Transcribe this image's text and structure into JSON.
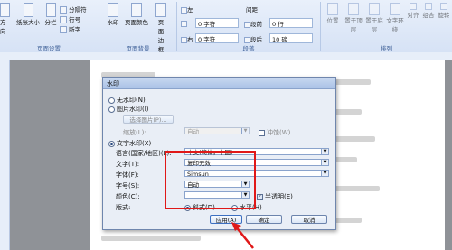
{
  "ribbon": {
    "row1": {
      "text_direction": "方向",
      "margins": "纸张大小",
      "columns": "分栏",
      "breaks": "分隔符",
      "line_numbers": "行号",
      "hyphenation": "断字",
      "watermark": "水印",
      "page_color": "页面颜色",
      "page_border": "页面边框"
    },
    "indent": {
      "left_label": "左",
      "left_value": "0 字符",
      "right_label": "右",
      "right_value": "0 字符"
    },
    "spacing": {
      "title": "间距",
      "before_label": "段前",
      "before_value": "0 行",
      "after_label": "段后",
      "after_value": "10 磅"
    },
    "groups": {
      "page_setup": "页面设置",
      "page_background": "页面背景",
      "paragraph": "段落",
      "arrange": "排列"
    },
    "arrange_items": [
      "位置",
      "置于顶层",
      "置于底层",
      "文字环绕",
      "对齐",
      "组合",
      "旋转"
    ]
  },
  "dialog": {
    "title": "水印",
    "no_watermark": "无水印(N)",
    "picture_watermark": "图片水印(I)",
    "select_picture": "选择图片(P)...",
    "scale_label": "缩放(L):",
    "scale_value": "自动",
    "washout": "冲蚀(W)",
    "text_watermark": "文字水印(X)",
    "language_label": "语言(国家/地区)(L):",
    "language_value": "中文(简体，中国)",
    "text_label": "文字(T):",
    "text_value": "复印无效",
    "font_label": "字体(F):",
    "font_value": "Simsun",
    "size_label": "字号(S):",
    "size_value": "自动",
    "color_label": "颜色(C):",
    "semitransparent": "半透明(E)",
    "layout_label": "版式:",
    "diagonal": "斜式(D)",
    "horizontal": "水平(H)",
    "apply": "应用(A)",
    "ok": "确定",
    "cancel": "取消",
    "selected_type": "text_watermark",
    "semitransparent_checked": true,
    "layout_selected": "diagonal"
  },
  "colors": {
    "highlight": "#e01818",
    "ribbon_bg": "#dbe6f6",
    "dialog_bg": "#e9eef6"
  }
}
